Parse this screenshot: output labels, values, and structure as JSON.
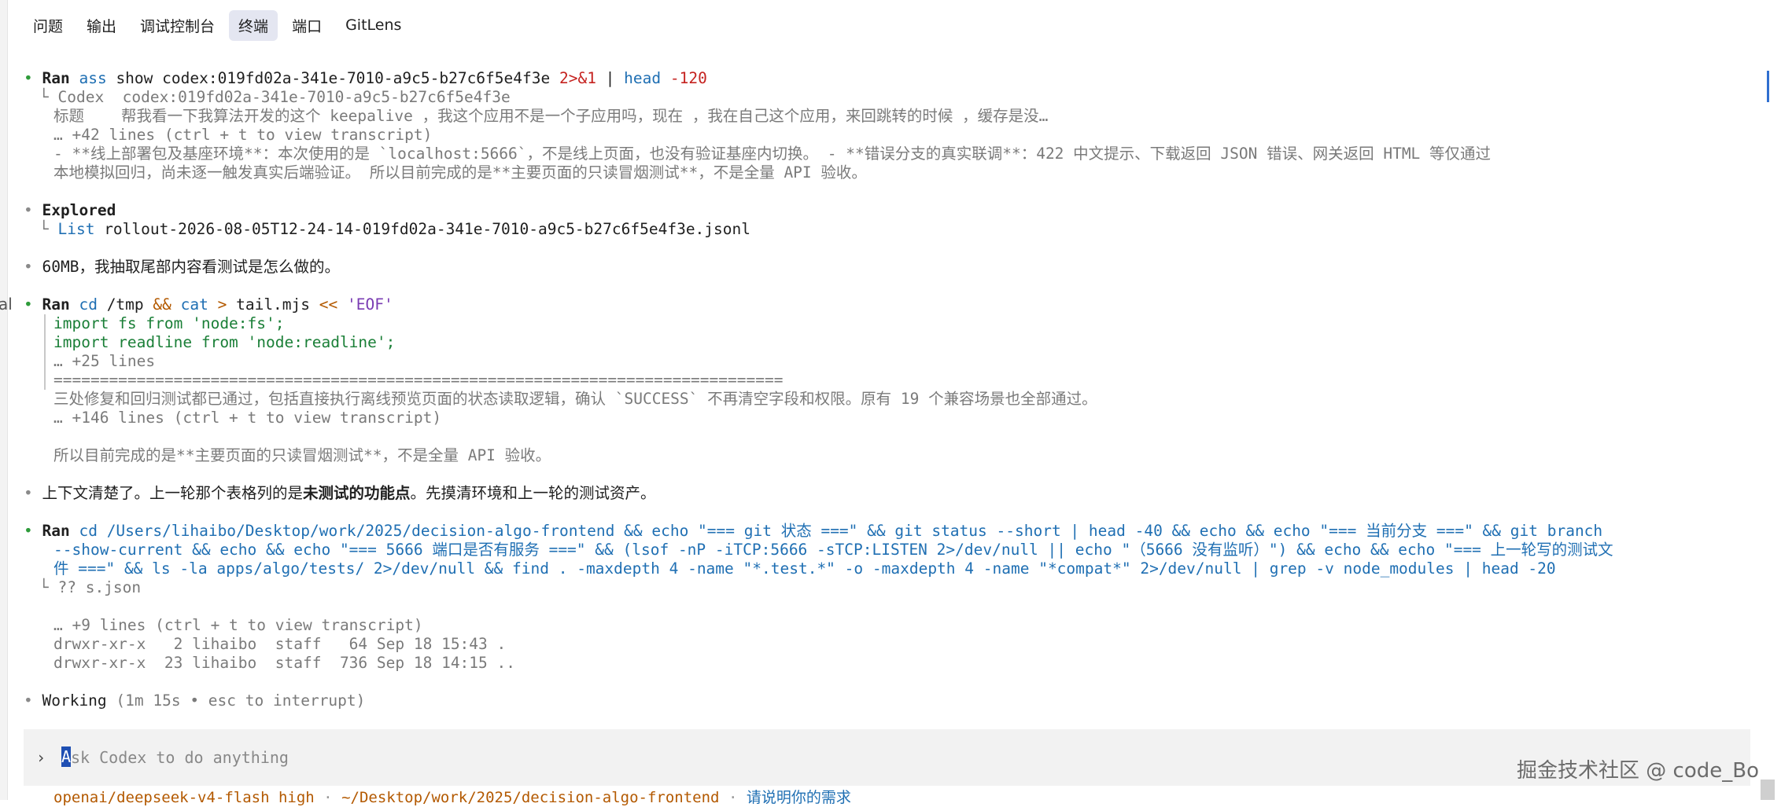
{
  "tabs": [
    "问题",
    "输出",
    "调试控制台",
    "终端",
    "端口",
    "GitLens"
  ],
  "active_tab": "终端",
  "left_fragment": "al",
  "blocks": {
    "b1": {
      "label": "Ran",
      "cmd_ass": "ass",
      "cmd_rest": " show codex:019fd02a-341e-7010-a9c5-b27c6f5e4f3e ",
      "redir": "2>&1",
      "pipe": " | ",
      "head": "head",
      "head_arg": " -120",
      "out1": "└ Codex  codex:019fd02a-341e-7010-a9c5-b27c6f5e4f3e",
      "out2": "标题    帮我看一下我算法开发的这个 keepalive ，我这个应用不是一个子应用吗，现在 ，我在自己这个应用，来回跳转的时候 ，缓存是没…",
      "out3": "… +42 lines (ctrl + t to view transcript)",
      "out4": "- **线上部署包及基座环境**：本次使用的是 `localhost:5666`，不是线上页面，也没有验证基座内切换。 - **错误分支的真实联调**：422 中文提示、下载返回 JSON 错误、网关返回 HTML 等仅通过",
      "out5": "本地模拟回归，尚未逐一触发真实后端验证。 所以目前完成的是**主要页面的只读冒烟测试**，不是全量 API 验收。"
    },
    "b2": {
      "label": "Explored",
      "list": "List",
      "file": " rollout-2026-08-05T12-24-14-019fd02a-341e-7010-a9c5-b27c6f5e4f3e.jsonl"
    },
    "b3": {
      "text": "60MB，我抽取尾部内容看测试是怎么做的。"
    },
    "b4": {
      "label": "Ran",
      "cd": "cd",
      "path": " /tmp ",
      "and": "&&",
      "cat": " cat",
      "redir": " > ",
      "file": "tail.mjs ",
      "heredoc": "<<",
      "eof": " 'EOF'",
      "l1": "import fs from 'node:fs';",
      "l2": "import readline from 'node:readline';",
      "l3": "… +25 lines",
      "l4": "===============================================================================",
      "l5": "三处修复和回归测试都已通过，包括直接执行离线预览页面的状态读取逻辑，确认 `SUCCESS` 不再清空字段和权限。原有 19 个兼容场景也全部通过。",
      "l6": "… +146 lines (ctrl + t to view transcript)",
      "l7": "所以目前完成的是**主要页面的只读冒烟测试**，不是全量 API 验收。"
    },
    "b5": {
      "pre": "上下文清楚了。上一轮那个表格列的是",
      "bold": "未测试的功能点",
      "post": "。先摸清环境和上一轮的测试资产。"
    },
    "b6": {
      "label": "Ran",
      "line1": "cd /Users/lihaibo/Desktop/work/2025/decision-algo-frontend && echo \"=== git 状态 ===\" && git status --short | head -40 && echo && echo \"=== 当前分支 ===\" && git branch",
      "line2": "--show-current && echo && echo \"=== 5666 端口是否有服务 ===\" && (lsof -nP -iTCP:5666 -sTCP:LISTEN 2>/dev/null || echo \"（5666 没有监听）\") && echo && echo \"=== 上一轮写的测试文",
      "line3": "件 ===\" && ls -la apps/algo/tests/ 2>/dev/null && find . -maxdepth 4 -name \"*.test.*\" -o -maxdepth 4 -name \"*compat*\" 2>/dev/null | grep -v node_modules | head -20",
      "out1": "└ ?? s.json",
      "out2": "… +9 lines (ctrl + t to view transcript)",
      "out3": "drwxr-xr-x   2 lihaibo  staff   64 Sep 18 15:43 .",
      "out4": "drwxr-xr-x  23 lihaibo  staff  736 Sep 18 14:15 .."
    },
    "b7": {
      "label": "Working",
      "detail": " (1m 15s • esc to interrupt)"
    }
  },
  "input": {
    "prompt": "›",
    "caret_char": "A",
    "placeholder": "sk Codex to do anything"
  },
  "status": {
    "model": "openai/deepseek-v4-flash high",
    "sep": " · ",
    "path": "~/Desktop/work/2025/decision-algo-frontend",
    "hint": "请说明你的需求"
  },
  "watermark": "掘金技术社区 @ code_Bo",
  "colors": {
    "bullet_green": "#2e9b3a",
    "command_blue": "#1f6fb3",
    "string_green": "#1a7f37",
    "flag_red": "#c5221f",
    "active_tab_bg": "#e4e6f1"
  }
}
